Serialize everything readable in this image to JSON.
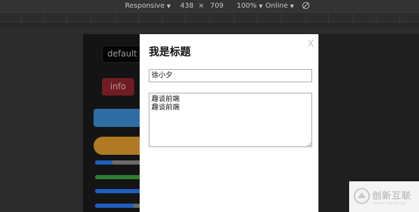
{
  "devtools": {
    "device": "Responsive",
    "width": "438",
    "times": "×",
    "height": "709",
    "zoom": "100%",
    "network": "Online",
    "rotate_icon": "rotate-icon"
  },
  "page": {
    "default_button": "default",
    "info_button": "info",
    "progress_bars": [
      {
        "color": "#1f5fbf",
        "fill": 0.25
      },
      {
        "color": "#2e7d32",
        "fill": 1.0
      },
      {
        "color": "#1f5fbf",
        "fill": 1.0
      },
      {
        "color": "#1f5fbf",
        "fill": 0.55
      }
    ]
  },
  "modal": {
    "title": "我是标题",
    "close": "X",
    "input_value": "徐小夕",
    "textarea_lines": [
      "趣谈前端",
      "趣谈前端"
    ]
  },
  "watermark": {
    "brand": "创新互联",
    "sub": "CHUANG XIN HU LIAN"
  }
}
